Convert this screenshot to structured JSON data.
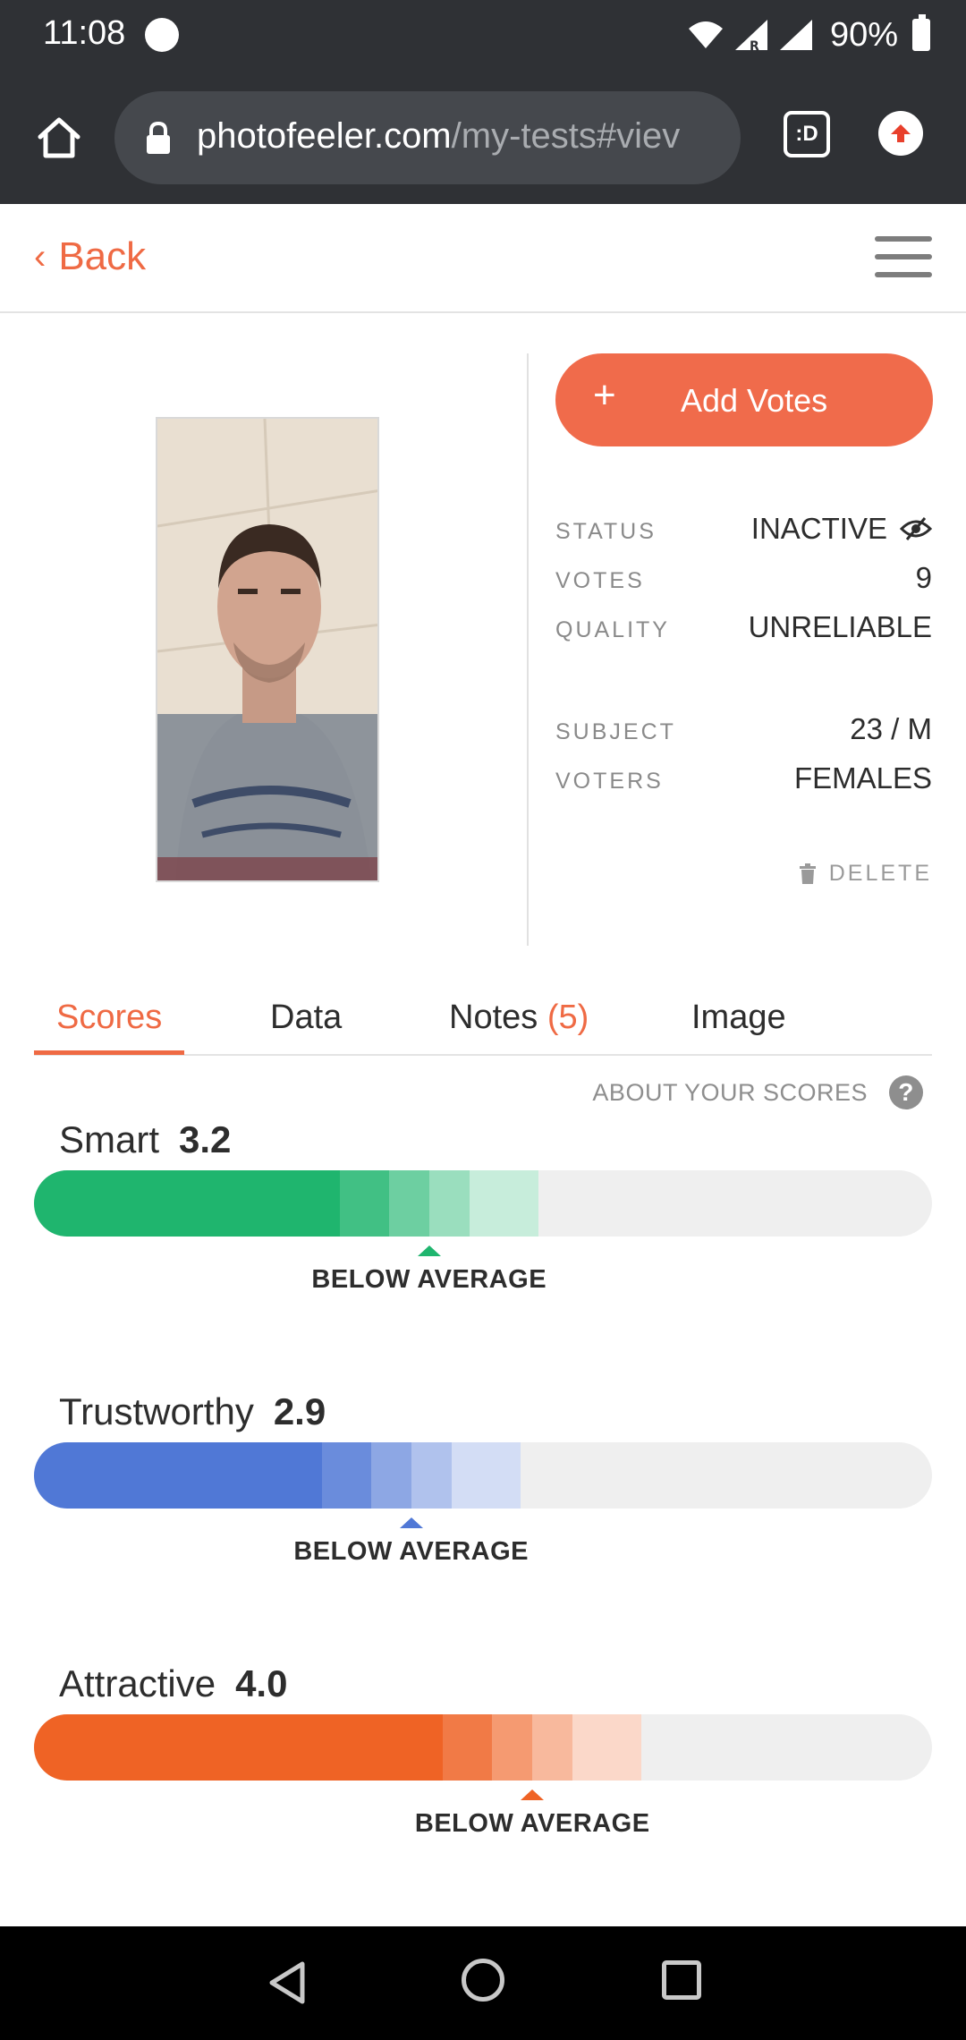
{
  "status_bar": {
    "time": "11:08",
    "battery": "90%"
  },
  "browser": {
    "url_host": "photofeeler.com",
    "url_path": "/my-tests#viev",
    "tab_icon_label": ":D"
  },
  "header": {
    "back_label": "Back"
  },
  "test": {
    "add_votes_label": "Add Votes",
    "add_votes_icon": "+",
    "rows": [
      {
        "label": "STATUS",
        "value": "INACTIVE"
      },
      {
        "label": "VOTES",
        "value": "9"
      },
      {
        "label": "QUALITY",
        "value": "UNRELIABLE"
      },
      {
        "label": "SUBJECT",
        "value": "23 / M"
      },
      {
        "label": "VOTERS",
        "value": "FEMALES"
      }
    ],
    "delete_label": "DELETE"
  },
  "tabs": {
    "scores": "Scores",
    "data": "Data",
    "notes": "Notes",
    "notes_count": "(5)",
    "image": "Image"
  },
  "about_scores": "ABOUT YOUR SCORES",
  "help_glyph": "?",
  "scores": [
    {
      "name": "Smart",
      "value": "3.2",
      "verdict": "BELOW AVERAGE",
      "color": "#1fb56e",
      "fill": 0.44
    },
    {
      "name": "Trustworthy",
      "value": "2.9",
      "verdict": "BELOW AVERAGE",
      "color": "#5078d6",
      "fill": 0.42
    },
    {
      "name": "Attractive",
      "value": "4.0",
      "verdict": "BELOW AVERAGE",
      "color": "#ef6325",
      "fill": 0.555
    }
  ],
  "colors": {
    "accent": "#ef6a44",
    "dark_bar": "#2f3135"
  },
  "icons": {
    "home": "home-icon",
    "lock": "lock-icon",
    "tab": "tabs-icon",
    "upload": "upload-icon",
    "menu": "hamburger-menu-icon",
    "hidden": "eye-slash-icon",
    "trash": "trash-icon",
    "help": "help-icon",
    "nav_back": "triangle-back-icon",
    "nav_home": "circle-home-icon",
    "nav_recent": "square-recent-icon"
  }
}
